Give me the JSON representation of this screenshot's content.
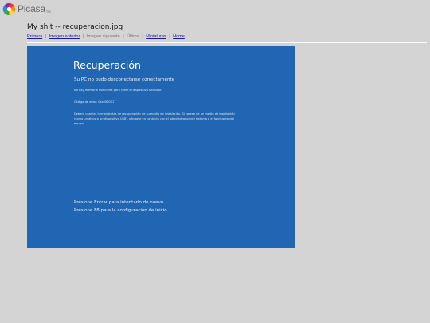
{
  "app": {
    "logo_text": "Picasa",
    "logo_tm": "TM",
    "logo_icon": "picasa-pinwheel-icon"
  },
  "page": {
    "title": "My shit -- recuperacion.jpg"
  },
  "nav": {
    "first": "Primera",
    "previous": "Imagen anterior",
    "next": "Imagen siguiente",
    "last": "Última",
    "thumbnails": "Miniaturas",
    "home": "Home",
    "separator": "|"
  },
  "photo": {
    "title": "Recuperación",
    "subtitle": "Su PC no pudo desconectarse correctamente",
    "line1": "No hay memoria suficiente para crear el dispositivo Ramdisk.",
    "line2": "Código de error: 0xc0000017",
    "paragraph": "Deberá usar las herramientas de recuperación de su medio de instalación. Si carece de un medio de instalación (como un disco o un dispositivo USB), póngase en contacto con el administrador del sistema o el fabricante del equipo.",
    "prompt1": "Presione Entrar para intentarlo de nuevo",
    "prompt2": "Presione F8 para la configuración de inicio",
    "background_color": "#2166b2"
  },
  "colors": {
    "page_background": "#d4d4d4",
    "link": "#1a1aa6"
  }
}
